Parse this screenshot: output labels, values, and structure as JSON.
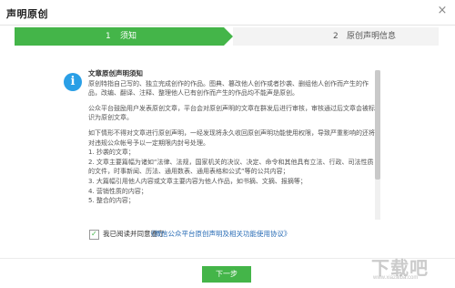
{
  "window": {
    "title": "声明原创",
    "close_icon": "×"
  },
  "steps": [
    {
      "number": "1",
      "label": "须知",
      "active": true
    },
    {
      "number": "2",
      "label": "原创声明信息",
      "active": false
    }
  ],
  "notice": {
    "icon_glyph": "i",
    "heading": "文章原创声明须知",
    "paragraphs": [
      "原创特指自己写的、独立完成创作的作品。图典、篡改他人创作或者抄袭、删组他人创作而产生的作品，改编、翻译、注释、整理他人已有创作而产生的作品均不能声是原创。",
      "公众平台鼓励用户发表原创文章，平台会对原创声明的文章在群发后进行审核，审核通过后文章会被标识为原创文章。",
      "如下情形不得对文章进行原创声明，一经发现将永久收回原创声明功能使用权限，导致严重影响的还将对违规公众帐号予以一定期限内封号处理。",
      "1. 抄袭的文章；",
      "2. 文章主要篇幅为诸如“法律、法规，国家机关的决议、决定、命令和其他具有立法、行政、司法性质的文件，时事新闻、历法、通用数表、通用表格和公式”等的公共内容；",
      "3. 大篇幅引用他人内容或文章主要内容为他人作品，如书摘、文摘、报摘等；",
      "4. 营销性质的内容；",
      "5. 整合的内容；"
    ]
  },
  "agreement": {
    "checked": true,
    "check_mark": "✓",
    "text": "我已阅读并同意遵守",
    "link": "《微信公众平台原创声明及相关功能使用协议》"
  },
  "footer": {
    "next_button": "下一步"
  },
  "watermark": {
    "text": "下载吧",
    "sub": "www.xiazaiba.com"
  },
  "colors": {
    "accent": "#44b549",
    "info_icon": "#2a9fe6",
    "link": "#2a6db6"
  }
}
